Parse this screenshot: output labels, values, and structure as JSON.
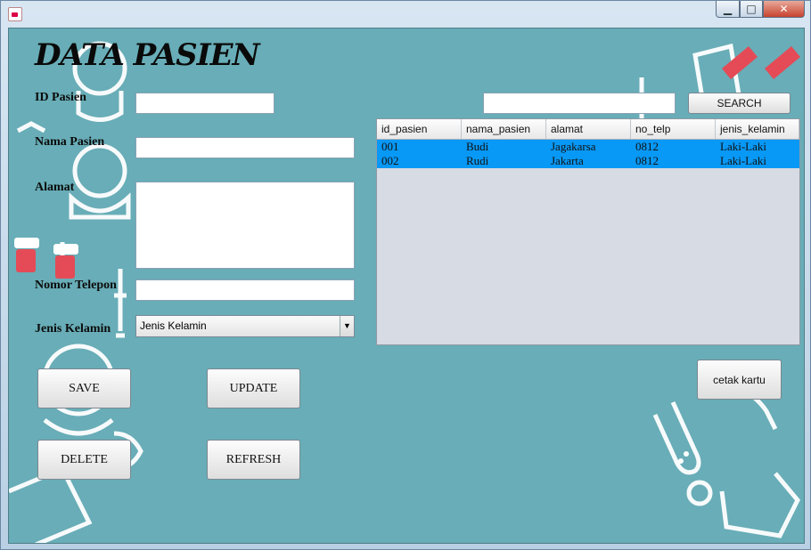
{
  "window": {
    "app_icon": "java-cup-icon",
    "buttons": {
      "minimize": "▁",
      "maximize": "□",
      "close": "✕"
    }
  },
  "title": "DATA PASIEN",
  "form": {
    "id_label": "ID Pasien",
    "nama_label": "Nama Pasien",
    "alamat_label": "Alamat",
    "telepon_label": "Nomor Telepon",
    "jk_label": "Jenis Kelamin",
    "jk_selected": "Jenis Kelamin"
  },
  "buttons": {
    "save": "SAVE",
    "update": "UPDATE",
    "delete": "DELETE",
    "refresh": "REFRESH",
    "search": "SEARCH",
    "cetak": "cetak kartu"
  },
  "table": {
    "headers": [
      "id_pasien",
      "nama_pasien",
      "alamat",
      "no_telp",
      "jenis_kelamin"
    ],
    "rows": [
      [
        "001",
        "Budi",
        "Jagakarsa",
        "0812",
        "Laki-Laki"
      ],
      [
        "002",
        "Rudi",
        "Jakarta",
        "0812",
        "Laki-Laki"
      ]
    ]
  },
  "colors": {
    "background": "#68adb7",
    "selection": "#0898f5"
  }
}
